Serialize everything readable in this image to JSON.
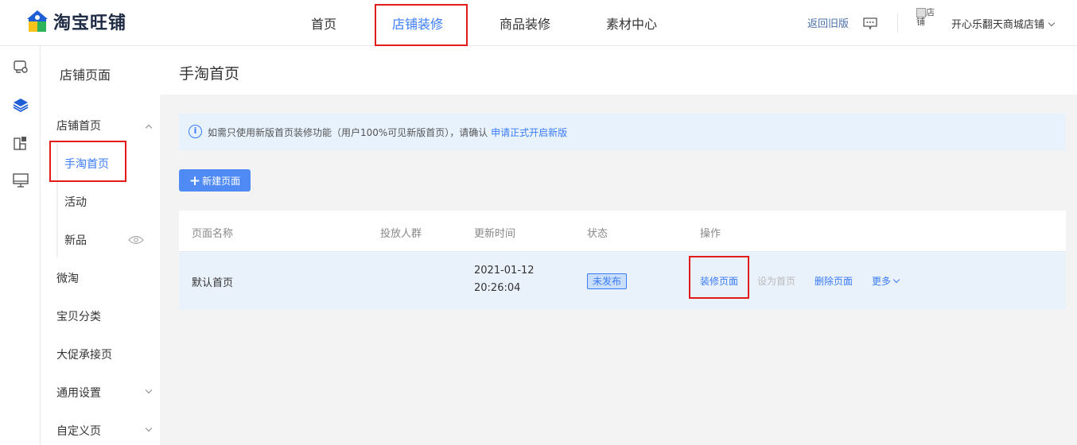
{
  "brand": {
    "name": "淘宝旺铺"
  },
  "topnav": {
    "items": [
      {
        "label": "首页"
      },
      {
        "label": "店铺装修",
        "active": true
      },
      {
        "label": "商品装修"
      },
      {
        "label": "素材中心"
      }
    ],
    "back_old": "返回旧版",
    "avatar_alt": "店铺",
    "shop_name": "开心乐翻天商城店铺"
  },
  "rail": {
    "icons": [
      "shop-settings-icon",
      "layers-icon",
      "modules-icon",
      "monitor-icon"
    ]
  },
  "sidebar": {
    "title": "店铺页面",
    "group": "店铺首页",
    "subs": [
      "手淘首页",
      "活动",
      "新品"
    ],
    "items": [
      "微淘",
      "宝贝分类",
      "大促承接页",
      "通用设置",
      "自定义页"
    ]
  },
  "main": {
    "title": "手淘首页",
    "notice": {
      "text": "如需只使用新版首页装修功能（用户100%可见新版首页），请确认",
      "link": "申请正式开启新版"
    },
    "new_button": "新建页面",
    "table": {
      "headers": [
        "页面名称",
        "投放人群",
        "更新时间",
        "状态",
        "操作"
      ],
      "row": {
        "name": "默认首页",
        "audience": "",
        "date": "2021-01-12",
        "time": "20:26:04",
        "status": "未发布",
        "actions": {
          "decorate": "装修页面",
          "set_home": "设为首页",
          "delete": "删除页面",
          "more": "更多"
        }
      }
    }
  },
  "colors": {
    "accent": "#3a7bf6",
    "highlight_box": "#e31b1b",
    "notice_bg": "#e8f2fd",
    "row_bg": "#e9f1fb"
  }
}
